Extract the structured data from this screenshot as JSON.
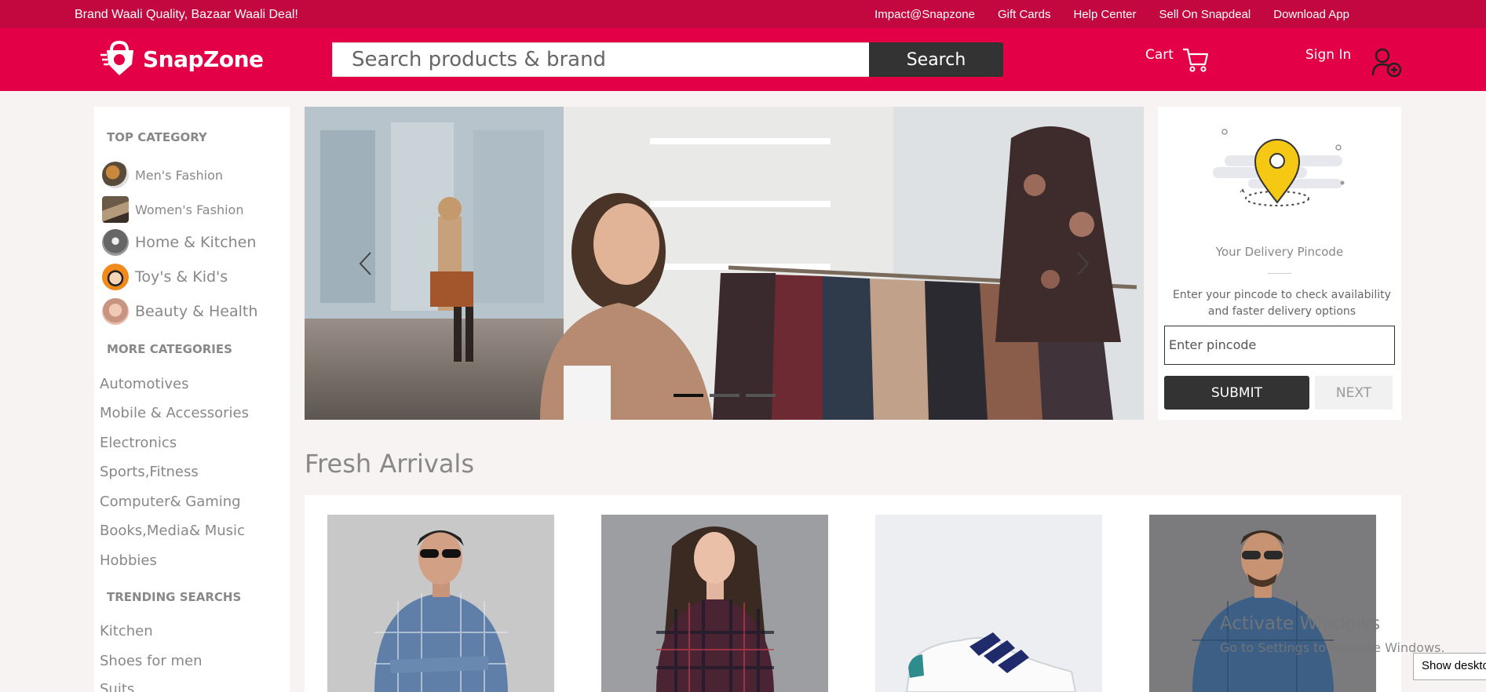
{
  "topbar": {
    "tagline": "Brand Waali Quality, Bazaar Waali Deal!",
    "links": [
      "Impact@Snapzone",
      "Gift Cards",
      "Help Center",
      "Sell On Snapdeal",
      "Download App"
    ]
  },
  "header": {
    "logo_text": "SnapZone",
    "search_placeholder": "Search products & brand",
    "search_button": "Search",
    "cart_label": "Cart",
    "signin_label": "Sign In"
  },
  "sidebar": {
    "top_category_heading": "TOP CATEGORY",
    "top_categories": [
      {
        "label": "Men's Fashion",
        "thumb": "mens-fashion-thumb"
      },
      {
        "label": "Women's Fashion",
        "thumb": "womens-fashion-thumb"
      },
      {
        "label": "Home & Kitchen",
        "thumb": "home-kitchen-thumb"
      },
      {
        "label": "Toy's & Kid's",
        "thumb": "toys-kids-thumb"
      },
      {
        "label": "Beauty & Health",
        "thumb": "beauty-health-thumb"
      }
    ],
    "more_categories_heading": "MORE CATEGORIES",
    "more_categories": [
      "Automotives",
      "Mobile & Accessories",
      "Electronics",
      "Sports,Fitness",
      "Computer& Gaming",
      "Books,Media& Music",
      "Hobbies"
    ],
    "trending_heading": "TRENDING SEARCHS",
    "trending": [
      "Kitchen",
      "Shoes for men",
      "Suits"
    ]
  },
  "carousel": {
    "slides": 3,
    "active_slide": 1
  },
  "pincode": {
    "title": "Your Delivery Pincode",
    "description": "Enter your pincode to check availability and faster delivery options",
    "input_placeholder": "Enter pincode",
    "submit_label": "SUBMIT",
    "next_label": "NEXT"
  },
  "fresh_arrivals": {
    "title": "Fresh Arrivals",
    "products": [
      {
        "image": "man-checked-shirt"
      },
      {
        "image": "woman-plaid-shirt"
      },
      {
        "image": "white-sneaker"
      },
      {
        "image": "man-denim-shirt"
      }
    ]
  },
  "system": {
    "activate_title": "Activate Windows",
    "activate_sub": "Go to Settings to activate Windows.",
    "show_desktop": "Show desktop"
  },
  "colors": {
    "topbar": "#c2083f",
    "header": "#e40046",
    "button_dark": "#333333",
    "background": "#f7f3f3"
  }
}
